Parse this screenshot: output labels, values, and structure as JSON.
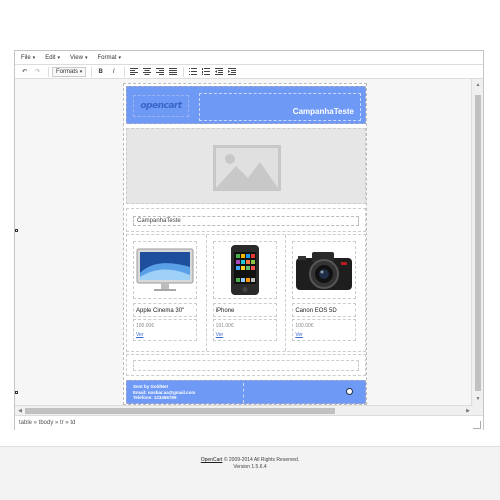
{
  "menubar": {
    "items": [
      {
        "label": "File"
      },
      {
        "label": "Edit"
      },
      {
        "label": "View"
      },
      {
        "label": "Format"
      }
    ]
  },
  "toolbar": {
    "formats_label": "Formats",
    "bold_label": "B",
    "italic_label": "I"
  },
  "email": {
    "logo_text": "opencart",
    "header_title": "CampanhaTeste",
    "campaign_name": "CampanhaTeste",
    "products": [
      {
        "name": "Apple Cinema 30\"",
        "price": "100.00€",
        "buy": "Ver"
      },
      {
        "name": "iPhone",
        "price": "101.00€",
        "buy": "Ver"
      },
      {
        "name": "Canon EOS 5D",
        "price": "100.00€",
        "buy": "Ver"
      }
    ],
    "footer_lines": [
      "Sent by GoldNet",
      "Email: nosbar.aa@gmail.com",
      "Telefone: 123456789"
    ]
  },
  "statusbar": {
    "path": "table » tbody » tr » td"
  },
  "page_footer": {
    "brand_link": "OpenCart",
    "copyright": "© 2009-2014 All Rights Reserved.",
    "version": "Version 1.5.6.4"
  }
}
